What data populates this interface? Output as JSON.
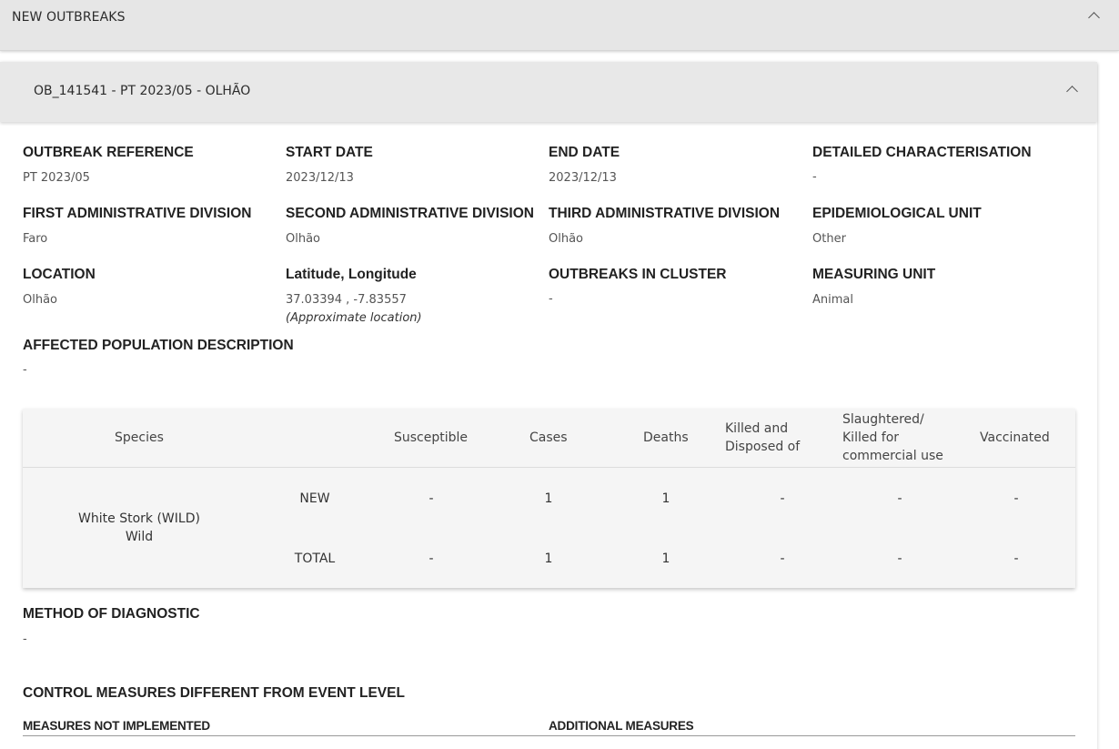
{
  "outer": {
    "title": "NEW OUTBREAKS"
  },
  "panel": {
    "title": "OB_141541 - PT 2023/05 - OLHÃO"
  },
  "fields": {
    "outbreak_reference": {
      "label": "OUTBREAK REFERENCE",
      "value": "PT 2023/05"
    },
    "start_date": {
      "label": "START DATE",
      "value": "2023/12/13"
    },
    "end_date": {
      "label": "END DATE",
      "value": "2023/12/13"
    },
    "detailed_characterisation": {
      "label": "DETAILED CHARACTERISATION",
      "value": "-"
    },
    "first_admin": {
      "label": "FIRST ADMINISTRATIVE DIVISION",
      "value": "Faro"
    },
    "second_admin": {
      "label": "SECOND ADMINISTRATIVE DIVISION",
      "value": "Olhão"
    },
    "third_admin": {
      "label": "THIRD ADMINISTRATIVE DIVISION",
      "value": "Olhão"
    },
    "epi_unit": {
      "label": "EPIDEMIOLOGICAL UNIT",
      "value": "Other"
    },
    "location": {
      "label": "LOCATION",
      "value": "Olhão"
    },
    "lat_long": {
      "label": "Latitude, Longitude",
      "value": "37.03394 , -7.83557",
      "note": "(Approximate location)"
    },
    "outbreaks_in_cluster": {
      "label": "OUTBREAKS IN CLUSTER",
      "value": "-"
    },
    "measuring_unit": {
      "label": "MEASURING UNIT",
      "value": "Animal"
    },
    "affected_population": {
      "label": "AFFECTED POPULATION DESCRIPTION",
      "value": "-"
    },
    "method_of_diagnostic": {
      "label": "METHOD OF DIAGNOSTIC",
      "value": "-"
    }
  },
  "species_table": {
    "headers": {
      "species": "Species",
      "susceptible": "Susceptible",
      "cases": "Cases",
      "deaths": "Deaths",
      "killed_line1": "Killed and",
      "killed_line2": "Disposed of",
      "slaughtered_line1": "Slaughtered/",
      "slaughtered_line2": "Killed for",
      "slaughtered_line3": "commercial use",
      "vaccinated": "Vaccinated"
    },
    "species_name": "White Stork (WILD)",
    "species_type": "Wild",
    "rows": [
      {
        "label": "NEW",
        "susceptible": "-",
        "cases": "1",
        "deaths": "1",
        "killed": "-",
        "slaughtered": "-",
        "vaccinated": "-"
      },
      {
        "label": "TOTAL",
        "susceptible": "-",
        "cases": "1",
        "deaths": "1",
        "killed": "-",
        "slaughtered": "-",
        "vaccinated": "-"
      }
    ]
  },
  "control_measures": {
    "title": "CONTROL MEASURES DIFFERENT FROM EVENT LEVEL",
    "not_implemented": "MEASURES NOT IMPLEMENTED",
    "additional": "ADDITIONAL MEASURES"
  }
}
